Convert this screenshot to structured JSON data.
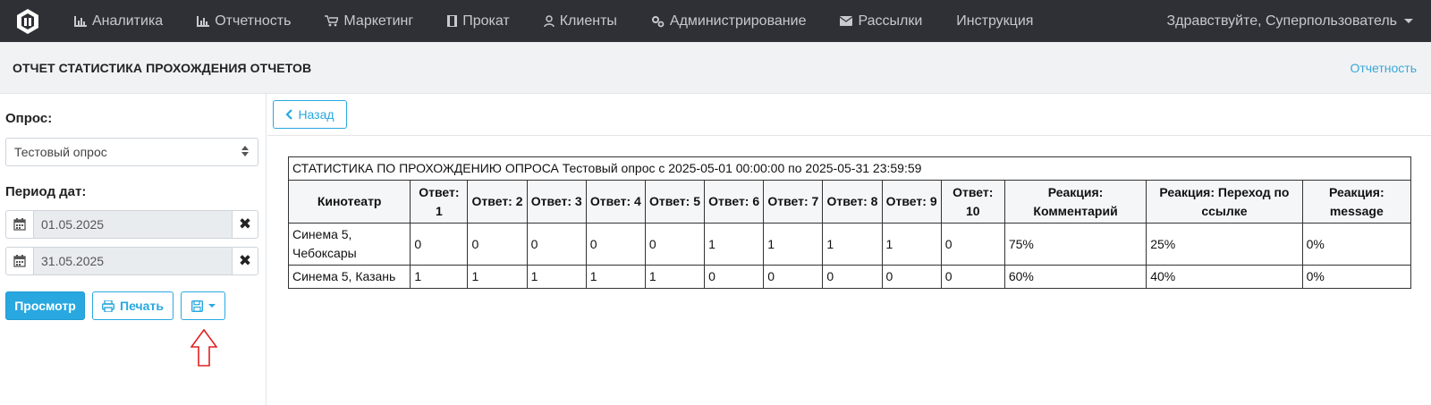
{
  "nav": {
    "items": [
      {
        "label": "Аналитика",
        "icon": "bar-chart-icon"
      },
      {
        "label": "Отчетность",
        "icon": "bar-chart-icon"
      },
      {
        "label": "Маркетинг",
        "icon": "cart-icon"
      },
      {
        "label": "Прокат",
        "icon": "film-icon"
      },
      {
        "label": "Клиенты",
        "icon": "user-icon"
      },
      {
        "label": "Администрирование",
        "icon": "cogs-icon"
      },
      {
        "label": "Рассылки",
        "icon": "envelope-icon"
      },
      {
        "label": "Инструкция",
        "icon": ""
      }
    ],
    "greeting": "Здравствуйте, Суперпользователь"
  },
  "header": {
    "title": "ОТЧЕТ СТАТИСТИКА ПРОХОЖДЕНИЯ ОТЧЕТОВ",
    "link": "Отчетность"
  },
  "sidebar": {
    "survey_label": "Опрос:",
    "survey_value": "Тестовый опрос",
    "period_label": "Период дат:",
    "date_from": "01.05.2025",
    "date_to": "31.05.2025",
    "clear_symbol": "✖",
    "view_button": "Просмотр",
    "print_button": "Печать"
  },
  "toolbar": {
    "back_button": "Назад"
  },
  "report": {
    "caption": "СТАТИСТИКА ПО ПРОХОЖДЕНИЮ ОПРОСА Тестовый опрос с 2025-05-01 00:00:00 по 2025-05-31 23:59:59",
    "headers": [
      "Кинотеатр",
      "Ответ: 1",
      "Ответ: 2",
      "Ответ: 3",
      "Ответ: 4",
      "Ответ: 5",
      "Ответ: 6",
      "Ответ: 7",
      "Ответ: 8",
      "Ответ: 9",
      "Ответ: 10",
      "Реакция: Комментарий",
      "Реакция: Переход по ссылке",
      "Реакция: message"
    ],
    "rows": [
      [
        "Синема 5, Чебоксары",
        "0",
        "0",
        "0",
        "0",
        "0",
        "1",
        "1",
        "1",
        "1",
        "0",
        "75%",
        "25%",
        "0%"
      ],
      [
        "Синема 5, Казань",
        "1",
        "1",
        "1",
        "1",
        "1",
        "0",
        "0",
        "0",
        "0",
        "0",
        "60%",
        "40%",
        "0%"
      ]
    ]
  },
  "colors": {
    "navbar_bg": "#2f3036",
    "accent": "#29a8e0",
    "annotation_arrow": "#e02020"
  }
}
